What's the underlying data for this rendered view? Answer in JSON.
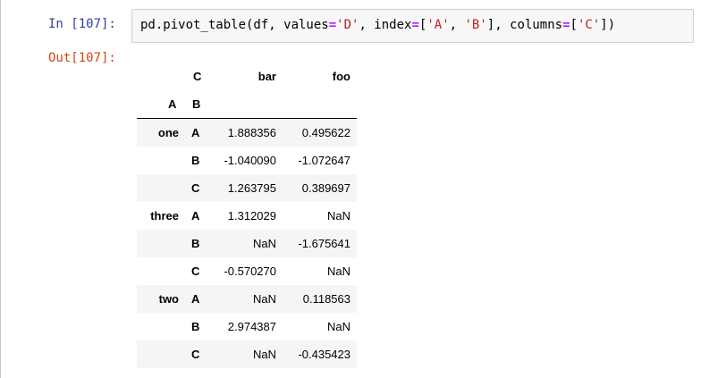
{
  "cell": {
    "in_prompt": "In [107]:",
    "out_prompt": "Out[107]:",
    "code": {
      "fn": "pd.pivot_table(df, values",
      "op1": "=",
      "s1": "'D'",
      "mid1": ", index",
      "op2": "=",
      "br1": "[",
      "s2": "'A'",
      "comma1": ", ",
      "s3": "'B'",
      "mid2": "], columns",
      "op3": "=",
      "br2": "[",
      "s4": "'C'",
      "end": "])"
    }
  },
  "table": {
    "columns_name": "C",
    "columns": [
      "bar",
      "foo"
    ],
    "index_names": [
      "A",
      "B"
    ],
    "rows": [
      {
        "a": "one",
        "b": "A",
        "bar": "1.888356",
        "foo": "0.495622"
      },
      {
        "a": "",
        "b": "B",
        "bar": "-1.040090",
        "foo": "-1.072647"
      },
      {
        "a": "",
        "b": "C",
        "bar": "1.263795",
        "foo": "0.389697"
      },
      {
        "a": "three",
        "b": "A",
        "bar": "1.312029",
        "foo": "NaN"
      },
      {
        "a": "",
        "b": "B",
        "bar": "NaN",
        "foo": "-1.675641"
      },
      {
        "a": "",
        "b": "C",
        "bar": "-0.570270",
        "foo": "NaN"
      },
      {
        "a": "two",
        "b": "A",
        "bar": "NaN",
        "foo": "0.118563"
      },
      {
        "a": "",
        "b": "B",
        "bar": "2.974387",
        "foo": "NaN"
      },
      {
        "a": "",
        "b": "C",
        "bar": "NaN",
        "foo": "-0.435423"
      }
    ]
  },
  "colors": {
    "in_prompt": "#303f9f",
    "out_prompt": "#d84315",
    "code_bg": "#f7f7f7",
    "string": "#ba2121",
    "operator": "#aa22ff",
    "stripe": "#f5f5f5"
  }
}
